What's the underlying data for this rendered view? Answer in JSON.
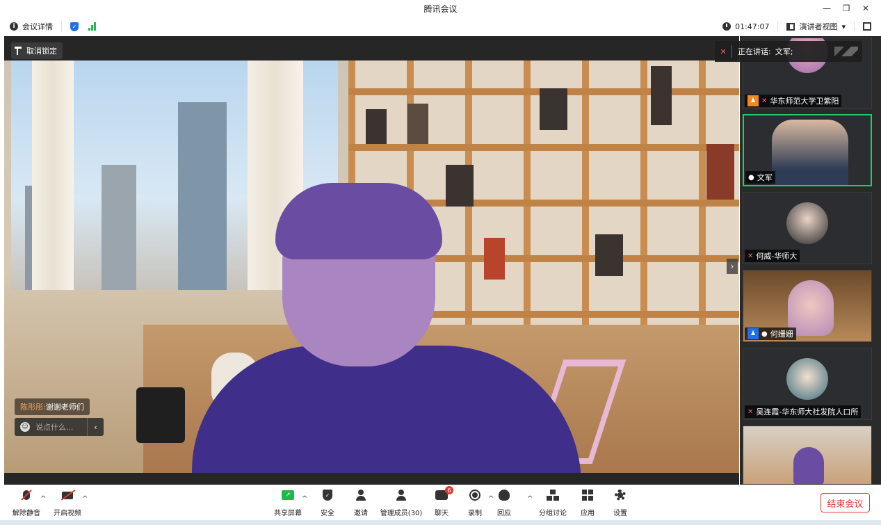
{
  "window": {
    "title": "腾讯会议",
    "min": "—",
    "restore": "❐",
    "close": "✕"
  },
  "infobar": {
    "meeting_details": "会议详情",
    "duration": "01:47:07",
    "view_mode": "演讲者视图",
    "view_caret": "▾"
  },
  "stage": {
    "unpin_label": "取消锁定",
    "speaking_label": "正在讲话:",
    "speaking_name": "文军;",
    "chat_sender": "陈彤彤:",
    "chat_text": "谢谢老师们",
    "chat_placeholder": "说点什么...",
    "collapse": "‹",
    "next": "›"
  },
  "participants": [
    {
      "name": "华东师范大学卫紫阳",
      "mic": "muted",
      "role": "host"
    },
    {
      "name": "文军",
      "mic": "on",
      "role": "",
      "active": true
    },
    {
      "name": "何威-华师大",
      "mic": "muted",
      "role": ""
    },
    {
      "name": "何姗姗",
      "mic": "on",
      "role": "cohost"
    },
    {
      "name": "吴连霞-华东师大社发院人口所",
      "mic": "muted",
      "role": ""
    },
    {
      "name": "",
      "mic": "",
      "role": ""
    }
  ],
  "toolbar": {
    "unmute": "解除静音",
    "start_video": "开启视频",
    "share_screen": "共享屏幕",
    "security": "安全",
    "invite": "邀请",
    "manage_members": "管理成员(30)",
    "chat": "聊天",
    "chat_badge": "6",
    "record": "录制",
    "react": "回应",
    "breakout": "分组讨论",
    "apps": "应用",
    "settings": "设置",
    "end_meeting": "结束会议"
  },
  "colors": {
    "accent_green": "#1fce6a",
    "end_red": "#e53935",
    "host_orange": "#f08a1f",
    "cohost_blue": "#1e6fe8"
  }
}
